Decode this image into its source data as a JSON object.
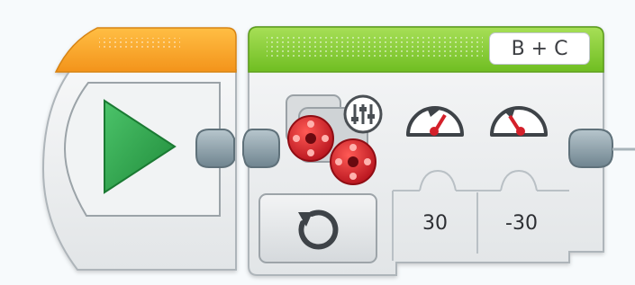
{
  "start_block": {
    "icon": "play-icon",
    "header_color": "#f5a21c",
    "body_color": "#eceeef"
  },
  "motor_block": {
    "ports_label": "B + C",
    "header_color": "#8ccf2e",
    "motor_icon": "large-motor-pair-icon",
    "mode_icon": "settings-sliders-icon",
    "mode_button_icon": "reset-rotate-icon",
    "params": [
      {
        "icon": "speed-gauge-icon",
        "value": "30"
      },
      {
        "icon": "speed-gauge-icon",
        "value": "-30"
      }
    ]
  },
  "colors": {
    "play_green": "#2fa84f",
    "motor_red": "#d4202a",
    "connector": "#8ea2ac"
  }
}
